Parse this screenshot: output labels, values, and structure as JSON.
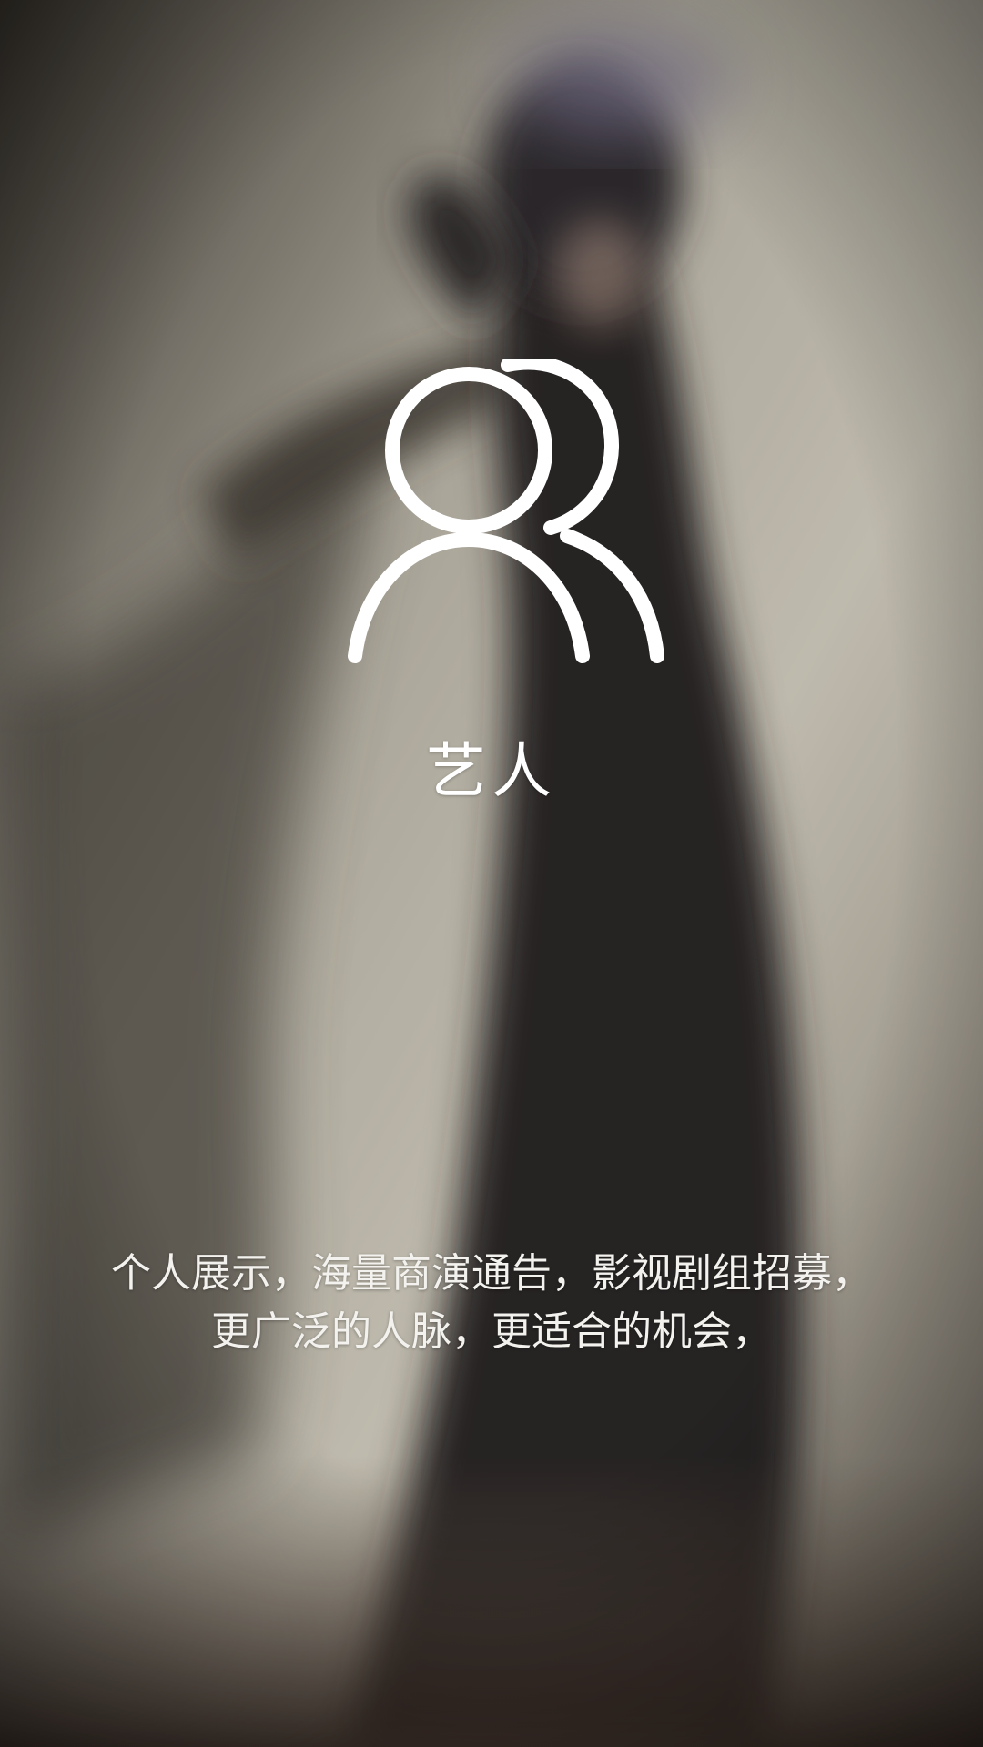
{
  "screen": {
    "icon": "user-group-icon",
    "title": "艺人",
    "description_lines": [
      "个人展示，海量商演通告，影视剧组招募，",
      "更广泛的人脉，更适合的机会，"
    ]
  },
  "colors": {
    "text": "#ffffff",
    "icon_stroke": "#ffffff",
    "background_light": "#c9c4b6",
    "background_dark": "#2a2628"
  }
}
